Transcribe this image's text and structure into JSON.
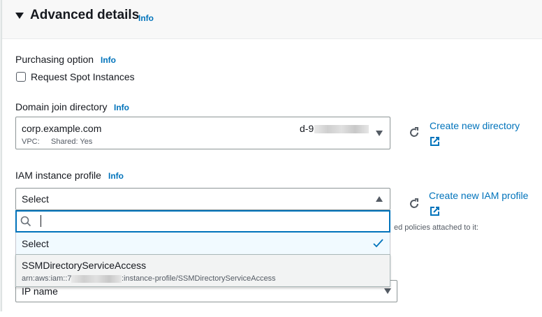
{
  "section": {
    "title": "Advanced details",
    "info": "Info"
  },
  "purchasing": {
    "label": "Purchasing option",
    "info": "Info",
    "checkbox_label": "Request Spot Instances",
    "checked": false
  },
  "domain": {
    "label": "Domain join directory",
    "info": "Info",
    "value": "corp.example.com",
    "id_prefix": "d-9",
    "vpc_label": "VPC:",
    "shared": "Shared: Yes",
    "create_link": "Create new directory"
  },
  "iam": {
    "label": "IAM instance profile",
    "info": "Info",
    "value": "Select",
    "search_placeholder": "",
    "create_link": "Create new IAM profile",
    "behind_text": "ed policies attached to it:",
    "options": [
      {
        "label": "Select",
        "selected": true
      },
      {
        "label": "SSMDirectoryServiceAccess",
        "arn_prefix": "arn:aws:iam::7",
        "arn_suffix": ":instance-profile/SSMDirectoryServiceAccess"
      }
    ]
  },
  "hostname": {
    "value": "IP name"
  }
}
